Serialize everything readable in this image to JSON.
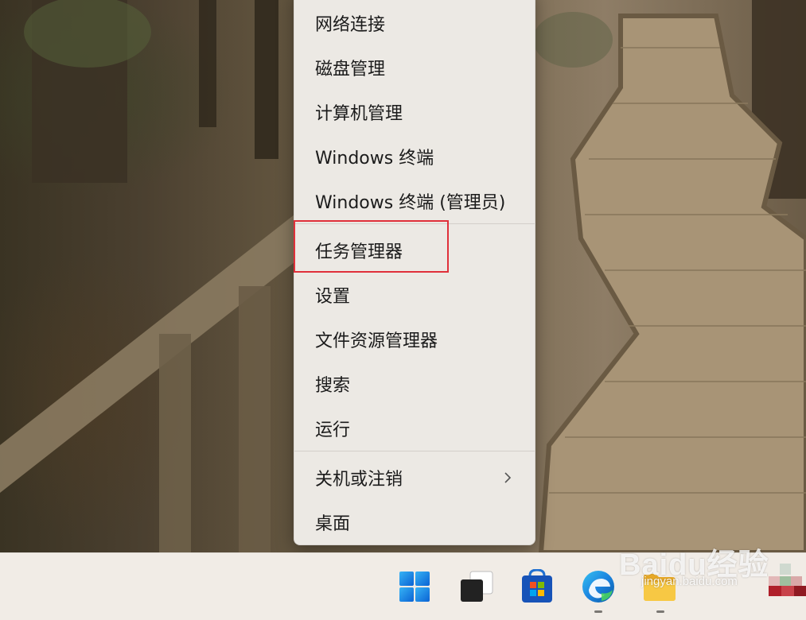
{
  "menu": {
    "items": [
      {
        "label": "网络连接"
      },
      {
        "label": "磁盘管理"
      },
      {
        "label": "计算机管理"
      },
      {
        "label": "Windows 终端"
      },
      {
        "label": "Windows 终端 (管理员)"
      },
      {
        "label": "任务管理器"
      },
      {
        "label": "设置"
      },
      {
        "label": "文件资源管理器"
      },
      {
        "label": "搜索"
      },
      {
        "label": "运行"
      },
      {
        "label": "关机或注销"
      },
      {
        "label": "桌面"
      }
    ],
    "highlighted_item": "任务管理器"
  },
  "taskbar": {
    "icons": [
      {
        "name": "start-icon"
      },
      {
        "name": "task-view-icon"
      },
      {
        "name": "microsoft-store-icon"
      },
      {
        "name": "edge-icon",
        "running": true
      },
      {
        "name": "file-explorer-icon",
        "running": true
      }
    ]
  },
  "watermark": {
    "brand": "Baidu经验",
    "url": "jingyan.baidu.com"
  },
  "colors": {
    "highlight_border": "#e0303a",
    "menu_background": "#ece9e4",
    "taskbar_background": "#f1ece6"
  }
}
